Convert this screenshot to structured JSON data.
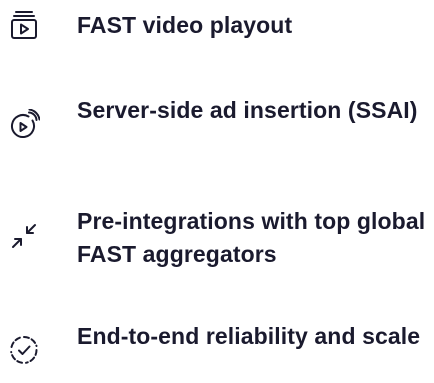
{
  "features": [
    {
      "icon": "video-playlist-icon",
      "label": "FAST video playout"
    },
    {
      "icon": "broadcast-play-icon",
      "label": "Server-side ad insertion (SSAI)"
    },
    {
      "icon": "minimize-arrows-icon",
      "label": "Pre-integrations with top global FAST aggregators"
    },
    {
      "icon": "verified-check-icon",
      "label": "End-to-end reliability and scale"
    }
  ],
  "colors": {
    "text": "#1a1a2e",
    "background": "#ffffff"
  }
}
